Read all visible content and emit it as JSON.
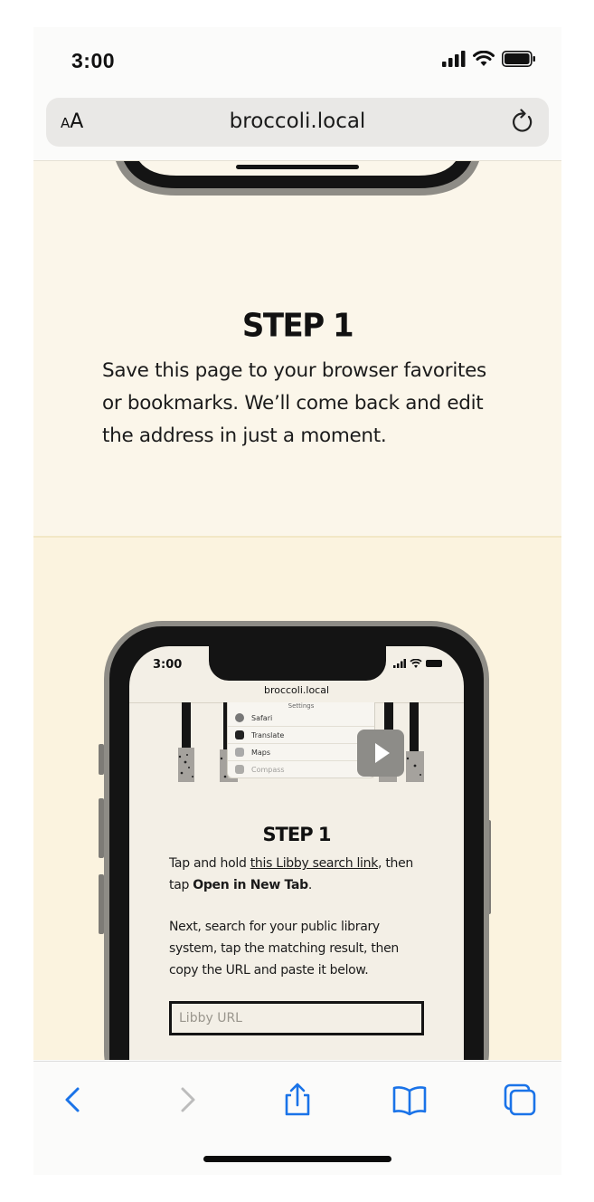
{
  "status_bar": {
    "time": "3:00"
  },
  "address_bar": {
    "aa_small": "A",
    "aa_large": "A",
    "url": "broccoli.local"
  },
  "step1": {
    "title": "STEP 1",
    "body": "Save this page to your browser favorites or bookmarks. We’ll come back and edit the address in just a moment."
  },
  "illustration": {
    "time": "3:00",
    "url": "broccoli.local",
    "settings_title": "Settings",
    "settings_items": [
      "Safari",
      "Translate",
      "Maps",
      "Compass"
    ],
    "step_title": "STEP 1",
    "line1_prefix": "Tap and hold ",
    "line1_link": "this Libby search link",
    "line1_suffix": ", then",
    "line2_prefix": "tap ",
    "line2_bold": "Open in New Tab",
    "line2_suffix": ".",
    "para2": "Next, search for your public library system, tap the matching result, then copy the URL and paste it below.",
    "input_placeholder": "Libby URL"
  },
  "colors": {
    "accent_blue": "#1a73e8",
    "page_bg": "#fbf6ea",
    "section2_bg": "#fbf3df"
  }
}
